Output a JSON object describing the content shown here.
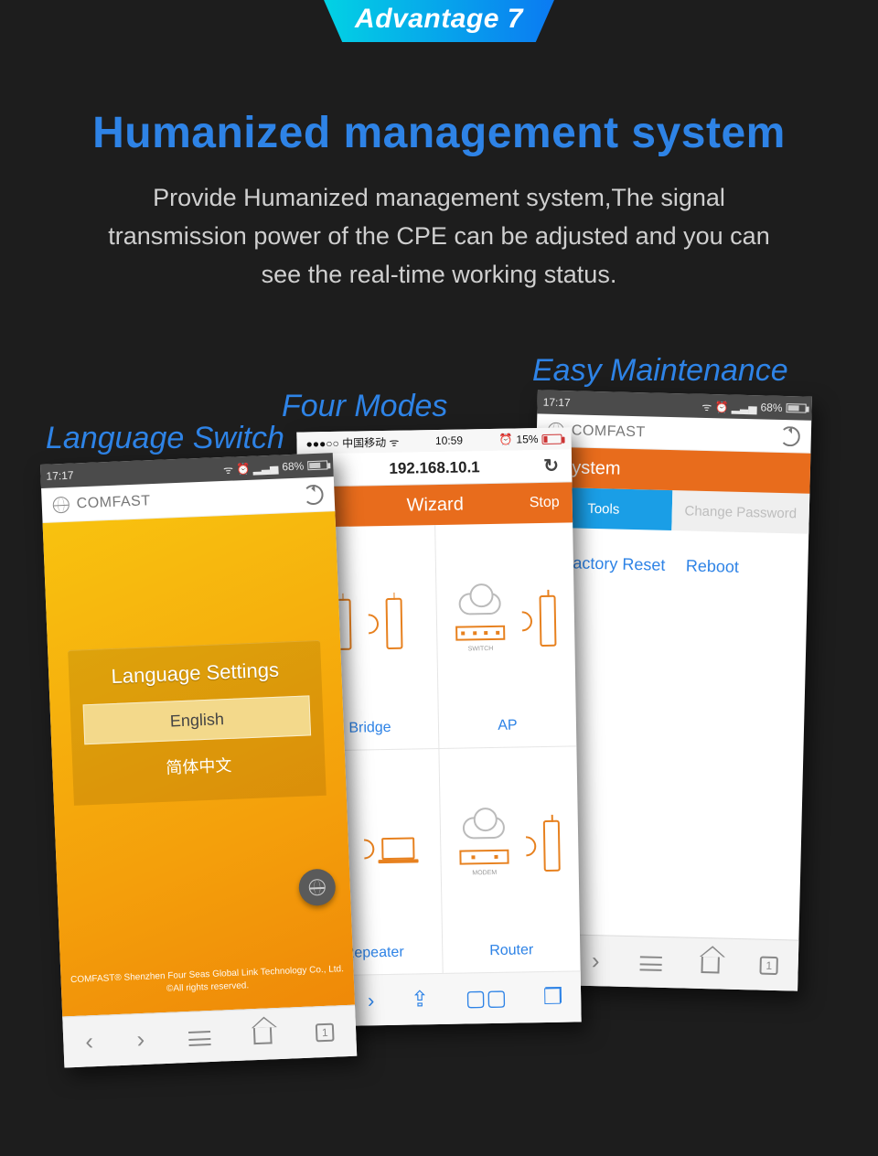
{
  "banner": {
    "tag": "Advantage 7",
    "title": "Humanized management system",
    "subtitle": "Provide Humanized management system,The signal transmission power of the CPE can be adjusted and you can see the real-time working status."
  },
  "captions": {
    "p1": "Language Switch",
    "p2": "Four Modes",
    "p3": "Easy Maintenance"
  },
  "phone1": {
    "status": {
      "time": "17:17",
      "battery": "68%"
    },
    "brand": "COMFAST",
    "card_title": "Language Settings",
    "option_en": "English",
    "option_zh": "简体中文",
    "footer_line1": "COMFAST® Shenzhen Four Seas Global Link Technology Co., Ltd.",
    "footer_line2": "©All rights reserved.",
    "tabcount": "1"
  },
  "phone2": {
    "status": {
      "carrier": "●●●○○ 中国移动 ᯤ",
      "time": "10:59",
      "alarm": "⏰",
      "battery": "15%"
    },
    "address": "192.168.10.1",
    "wizard": "Wizard",
    "stop": "Stop",
    "modes": {
      "bridge": "Bridge",
      "ap": "AP",
      "repeater": "Repeater",
      "router": "Router"
    },
    "switch_label": "SWITCH",
    "modem_label": "MODEM"
  },
  "phone3": {
    "status": {
      "time": "17:17",
      "battery": "68%"
    },
    "brand": "COMFAST",
    "section": "System",
    "tab_tools": "Tools",
    "tab_pw": "Change Password",
    "link_reset": "Factory Reset",
    "link_reboot": "Reboot",
    "tabcount": "1"
  }
}
